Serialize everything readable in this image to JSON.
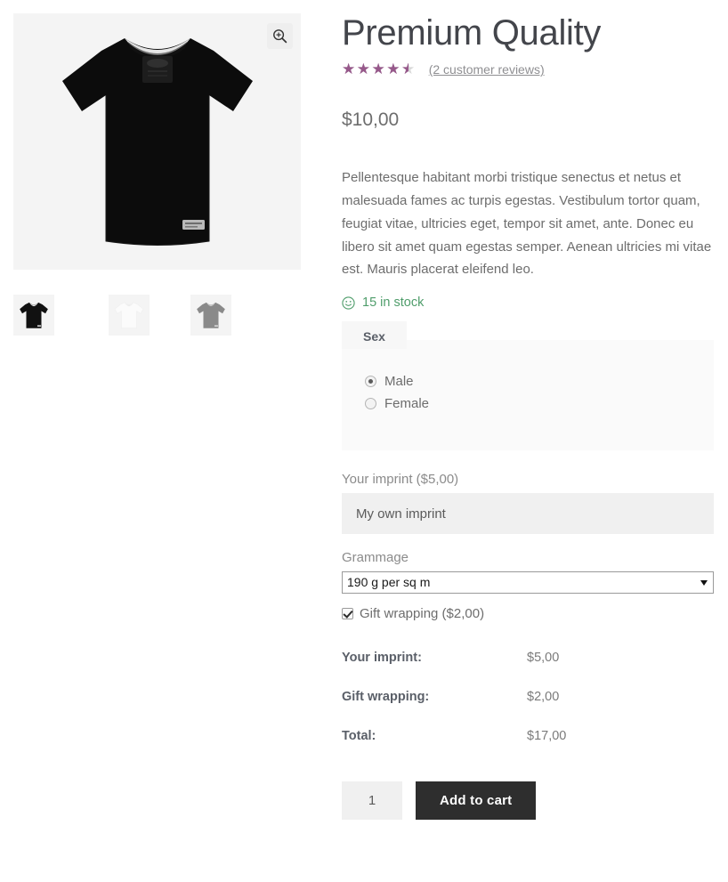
{
  "gallery": {
    "zoom_button_icon": "magnifier-plus-icon",
    "main_image_alt": "Black t-shirt front view",
    "thumbnails": [
      {
        "alt": "Black t-shirt thumbnail",
        "color": "#111111",
        "collar": "#e8e8e8"
      },
      {
        "alt": "White t-shirt thumbnail",
        "color": "#fbfbfb",
        "collar": "#ededed"
      },
      {
        "alt": "Grey t-shirt thumbnail",
        "color": "#8a8a8a",
        "collar": "#c9c9c9"
      }
    ]
  },
  "product": {
    "title": "Premium Quality",
    "rating_value": 4.5,
    "rating_max": 5,
    "rating_percent": "90%",
    "reviews_link": "(2 customer reviews)",
    "price": "$10,00",
    "description": "Pellentesque habitant morbi tristique senectus et netus et malesuada fames ac turpis egestas. Vestibulum tortor quam, feugiat vitae, ultricies eget, tempor sit amet, ante. Donec eu libero sit amet quam egestas semper. Aenean ultricies mi vitae est. Mauris placerat eleifend leo.",
    "stock_status": "15 in stock",
    "stock_icon": "smiley-face-icon",
    "stock_color": "#4f9d6b",
    "accent_color": "#96588a"
  },
  "options": {
    "sex": {
      "legend": "Sex",
      "choices": [
        {
          "label": "Male",
          "checked": true
        },
        {
          "label": "Female",
          "checked": false
        }
      ]
    },
    "imprint": {
      "label": "Your imprint ($5,00)",
      "value": "My own imprint",
      "placeholder": "My own imprint"
    },
    "grammage": {
      "label": "Grammage",
      "selected": "190 g per sq m",
      "options": [
        "190 g per sq m"
      ]
    },
    "gift_wrapping": {
      "label": "Gift wrapping ($2,00)",
      "checked": true
    }
  },
  "totals": {
    "rows": [
      {
        "label": "Your imprint:",
        "value": "$5,00"
      },
      {
        "label": "Gift wrapping:",
        "value": "$2,00"
      },
      {
        "label": "Total:",
        "value": "$17,00"
      }
    ]
  },
  "cart": {
    "quantity": "1",
    "add_to_cart_label": "Add to cart"
  }
}
